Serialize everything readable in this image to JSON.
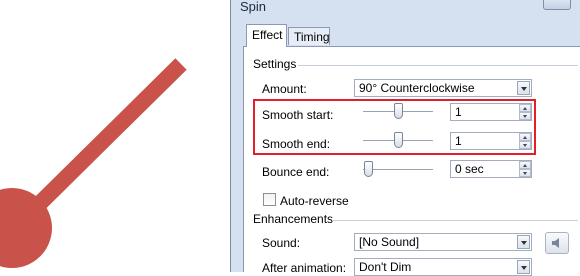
{
  "dialog": {
    "title": "Spin",
    "tabs": [
      {
        "label": "Effect",
        "active": true
      },
      {
        "label": "Timing",
        "active": false
      }
    ]
  },
  "settings": {
    "heading": "Settings",
    "amount": {
      "label": "Amount:",
      "value": "90° Counterclockwise"
    },
    "smooth_start": {
      "label": "Smooth start:",
      "value": "1"
    },
    "smooth_end": {
      "label": "Smooth end:",
      "value": "1"
    },
    "bounce_end": {
      "label": "Bounce end:",
      "value": "0 sec"
    },
    "auto_reverse": {
      "label": "Auto-reverse",
      "checked": false
    }
  },
  "enhancements": {
    "heading": "Enhancements",
    "sound": {
      "label": "Sound:",
      "value": "[No Sound]"
    },
    "after_animation": {
      "label": "After animation:",
      "value": "Don't Dim"
    }
  },
  "colors": {
    "highlight": "#e21f2a",
    "graphic": "#c9524a"
  }
}
